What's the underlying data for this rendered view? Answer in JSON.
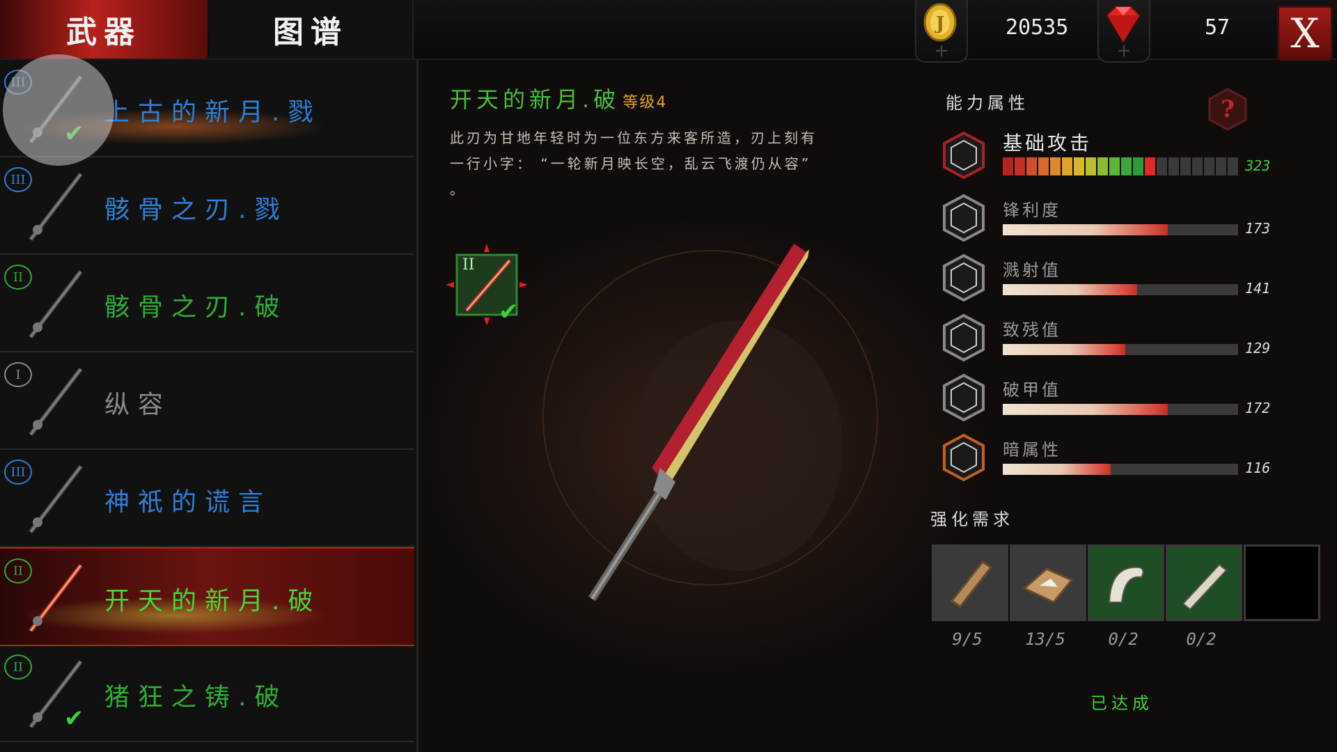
{
  "tabs": {
    "weapons": "武器",
    "codex": "图谱"
  },
  "resources": {
    "gold": "20535",
    "gems": "57",
    "gold_icon": "gold-coin-icon",
    "gem_icon": "red-gem-icon"
  },
  "close_label": "X",
  "weapon_list": [
    {
      "name": "上古的新月.戮",
      "tier": "III",
      "color": "#2f7fd6",
      "checked": true
    },
    {
      "name": "骸骨之刃.戮",
      "tier": "III",
      "color": "#2f7fd6",
      "checked": false
    },
    {
      "name": "骸骨之刃.破",
      "tier": "II",
      "color": "#2fae35",
      "checked": false
    },
    {
      "name": "纵容",
      "tier": "I",
      "color": "#8a8a8a",
      "checked": false
    },
    {
      "name": "神祇的谎言",
      "tier": "III",
      "color": "#2f7fd6",
      "checked": false
    },
    {
      "name": "开天的新月.破",
      "tier": "II",
      "color": "#2fae35",
      "checked": false,
      "selected": true
    },
    {
      "name": "猪狂之铸.破",
      "tier": "II",
      "color": "#2fae35",
      "checked": true
    }
  ],
  "detail": {
    "name": "开天的新月.破",
    "level": "等级4",
    "desc_line1": "此刃为甘地年轻时为一位东方来客所造，刃上刻有",
    "desc_line2": "一行小字：  “一轮新月映长空，乱云飞渡仍从容”",
    "desc_line3": "。",
    "badge_tier": "II"
  },
  "stats_title": "能力属性",
  "stats": [
    {
      "label": "基础攻击",
      "value": "323",
      "value_num": 323,
      "fraction": 0.65,
      "style": "segmented"
    },
    {
      "label": "锋利度",
      "value": "173",
      "value_num": 173,
      "fraction": 0.7
    },
    {
      "label": "溅射值",
      "value": "141",
      "value_num": 141,
      "fraction": 0.57
    },
    {
      "label": "致残值",
      "value": "129",
      "value_num": 129,
      "fraction": 0.52
    },
    {
      "label": "破甲值",
      "value": "172",
      "value_num": 172,
      "fraction": 0.7
    },
    {
      "label": "暗属性",
      "value": "116",
      "value_num": 116,
      "fraction": 0.46
    }
  ],
  "stat_icons": [
    "attack-icon",
    "sharpness-icon",
    "splash-icon",
    "cripple-icon",
    "armor-break-icon",
    "dark-element-icon"
  ],
  "enhance_title": "强化需求",
  "materials": [
    {
      "icon": "wood-material-icon",
      "count": "9/5",
      "bg": "#3a3a3a"
    },
    {
      "icon": "hide-material-icon",
      "count": "13/5",
      "bg": "#3a3a3a"
    },
    {
      "icon": "claw-material-icon",
      "count": "0/2",
      "bg": "#1f4d24"
    },
    {
      "icon": "bone-material-icon",
      "count": "0/2",
      "bg": "#1f4d24"
    },
    {
      "icon": "empty-slot",
      "count": "",
      "bg": "#000000"
    }
  ],
  "status_text": "已达成",
  "colors": {
    "accent_red": "#b8211c",
    "green": "#43c03a",
    "gold": "#e6a51c",
    "blue_tier": "#2f7fd6"
  }
}
